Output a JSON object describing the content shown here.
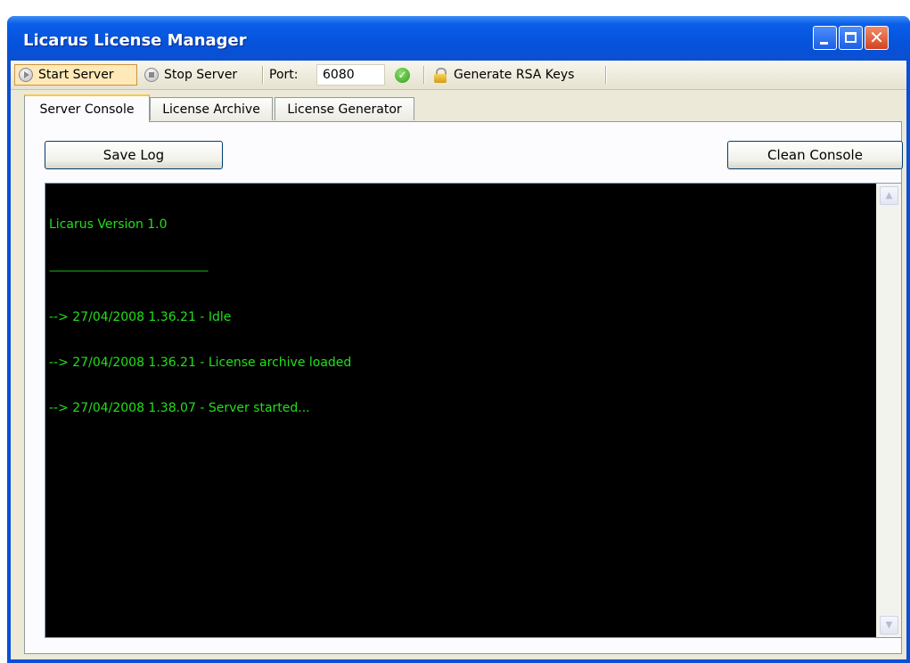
{
  "window": {
    "title": "Licarus License Manager"
  },
  "toolbar": {
    "start_label": "Start Server",
    "stop_label": "Stop Server",
    "port_label": "Port:",
    "port_value": "6080",
    "rsa_label": "Generate RSA Keys"
  },
  "tabs": [
    {
      "label": "Server Console",
      "active": true
    },
    {
      "label": "License Archive",
      "active": false
    },
    {
      "label": "License Generator",
      "active": false
    }
  ],
  "console_panel": {
    "save_label": "Save Log",
    "clean_label": "Clean Console",
    "lines": [
      "Licarus Version 1.0",
      "------------------------------------------------------------",
      "--> 27/04/2008 1.36.21 - Idle",
      "--> 27/04/2008 1.36.21 - License archive loaded",
      "--> 27/04/2008 1.38.07 - Server started..."
    ]
  },
  "colors": {
    "console_text": "#22e01a",
    "console_bg": "#000000",
    "titlebar": "#0653dc"
  }
}
